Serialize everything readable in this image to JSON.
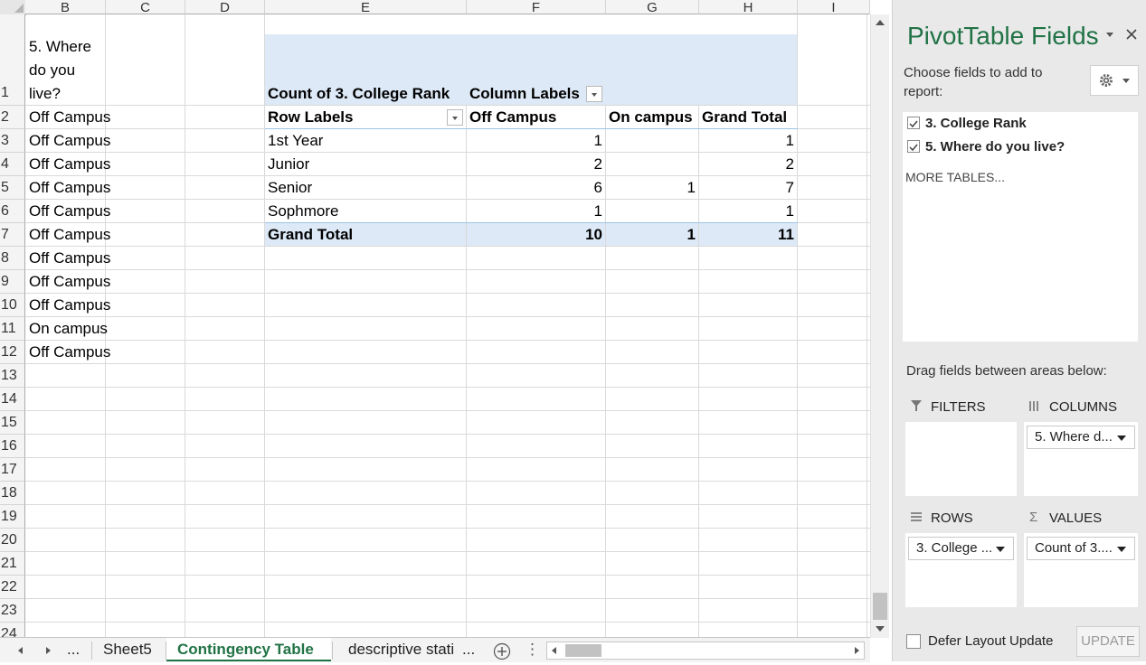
{
  "grid": {
    "columns": [
      "B",
      "C",
      "D",
      "E",
      "F",
      "G",
      "H",
      "I"
    ],
    "rows": [
      "1",
      "2",
      "3",
      "4",
      "5",
      "6",
      "7",
      "8",
      "9",
      "10",
      "11",
      "12",
      "13",
      "14",
      "15",
      "16",
      "17",
      "18",
      "19",
      "20",
      "21",
      "22",
      "23",
      "24"
    ],
    "b1_lines": [
      "5. Where",
      "do you",
      "live?"
    ],
    "colB_values": [
      "Off Campus",
      "Off Campus",
      "Off Campus",
      "Off Campus",
      "Off Campus",
      "Off Campus",
      "Off Campus",
      "Off Campus",
      "Off Campus",
      "On campus",
      "Off Campus"
    ]
  },
  "pivot": {
    "count_label": "Count of 3. College Rank",
    "column_labels": "Column Labels",
    "row_labels": "Row Labels",
    "col_headers": [
      "Off Campus",
      "On campus",
      "Grand Total"
    ],
    "rows": [
      {
        "label": "1st Year",
        "off": "1",
        "on": "",
        "total": "1"
      },
      {
        "label": "Junior",
        "off": "2",
        "on": "",
        "total": "2"
      },
      {
        "label": "Senior",
        "off": "6",
        "on": "1",
        "total": "7"
      },
      {
        "label": "Sophmore",
        "off": "1",
        "on": "",
        "total": "1"
      }
    ],
    "grand_total": {
      "label": "Grand Total",
      "off": "10",
      "on": "1",
      "total": "11"
    }
  },
  "tabs": {
    "ellipsis": "...",
    "sheet5": "Sheet5",
    "contingency": "Contingency Table",
    "descriptive": "descriptive stati",
    "more": "...",
    "menu": "⋮"
  },
  "pane": {
    "title": "PivotTable Fields",
    "choose": "Choose fields to add to report:",
    "fields": [
      {
        "label": "3. College Rank",
        "checked": true
      },
      {
        "label": "5. Where do you live?",
        "checked": true
      }
    ],
    "more_tables": "MORE TABLES...",
    "drag_hint": "Drag fields between areas below:",
    "filters": "FILTERS",
    "columns": "COLUMNS",
    "rows": "ROWS",
    "values": "VALUES",
    "columns_item": "5. Where d...",
    "rows_item": "3. College ...",
    "values_item": "Count of 3....",
    "defer": "Defer Layout Update",
    "update": "UPDATE"
  },
  "colors": {
    "accent": "#217346",
    "pivot_header": "#dde9f6"
  }
}
